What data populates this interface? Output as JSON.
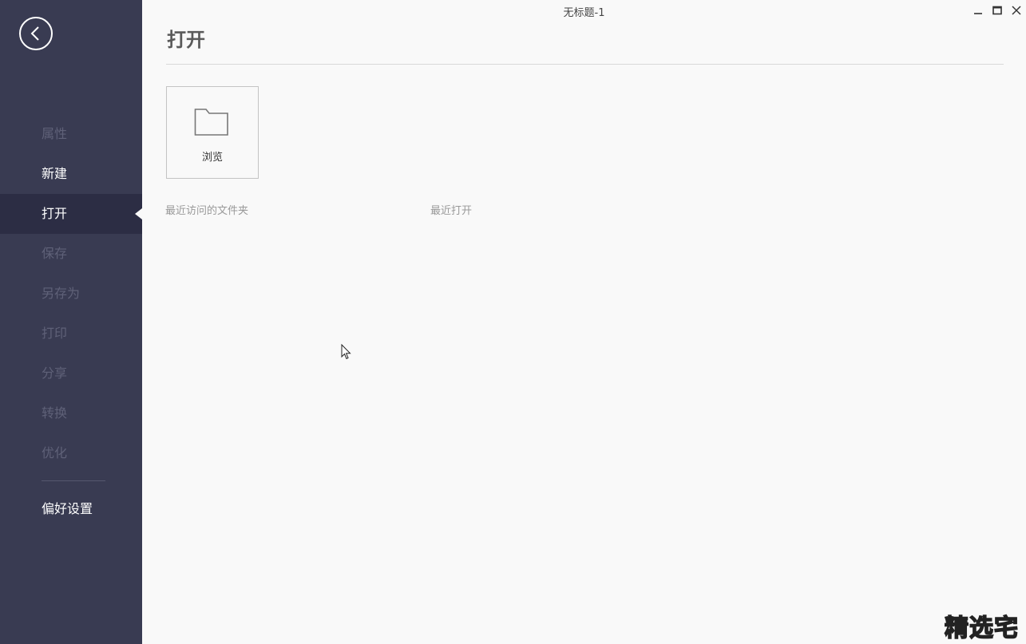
{
  "window": {
    "title": "无标题-1"
  },
  "sidebar": {
    "back_icon": "chevron-left-circle-icon",
    "items": [
      {
        "label": "属性",
        "state": "disabled"
      },
      {
        "label": "新建",
        "state": "enabled"
      },
      {
        "label": "打开",
        "state": "active"
      },
      {
        "label": "保存",
        "state": "disabled"
      },
      {
        "label": "另存为",
        "state": "disabled"
      },
      {
        "label": "打印",
        "state": "disabled"
      },
      {
        "label": "分享",
        "state": "disabled"
      },
      {
        "label": "转换",
        "state": "disabled"
      },
      {
        "label": "优化",
        "state": "disabled"
      }
    ],
    "preferences": {
      "label": "偏好设置"
    }
  },
  "main": {
    "title": "打开",
    "browse": {
      "label": "浏览",
      "icon": "folder-icon"
    },
    "recent_folders_label": "最近访问的文件夹",
    "recent_files_label": "最近打开"
  },
  "watermark": "精选宅",
  "colors": {
    "sidebar_bg": "#393b52",
    "sidebar_active_bg": "#2c2d44",
    "main_bg": "#f9f9f9",
    "disabled_text": "#5f6178"
  }
}
